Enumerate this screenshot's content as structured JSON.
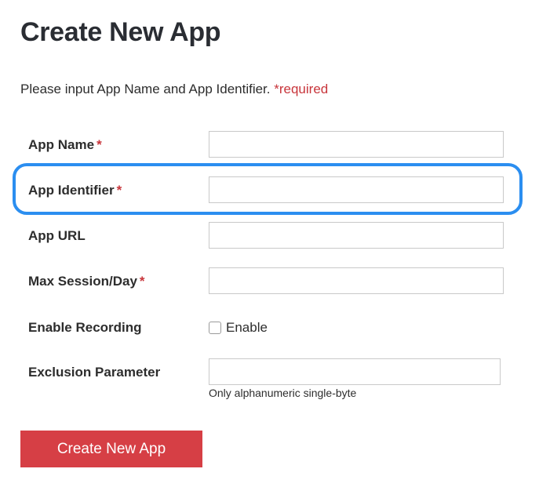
{
  "page": {
    "title": "Create New App",
    "intro": "Please input App Name and App Identifier. ",
    "intro_required": "*required"
  },
  "form": {
    "app_name": {
      "label": "App Name",
      "required_mark": "*",
      "value": ""
    },
    "app_identifier": {
      "label": "App Identifier",
      "required_mark": "*",
      "value": ""
    },
    "app_url": {
      "label": "App URL",
      "value": ""
    },
    "max_session": {
      "label": "Max Session/Day",
      "required_mark": "*",
      "value": ""
    },
    "enable_recording": {
      "label": "Enable Recording",
      "checkbox_label": "Enable",
      "checked": false
    },
    "exclusion_parameter": {
      "label": "Exclusion Parameter",
      "value": "",
      "hint": "Only alphanumeric single-byte"
    }
  },
  "submit": {
    "label": "Create New App"
  },
  "colors": {
    "accent": "#d63f45",
    "required": "#c8353b",
    "highlight": "#2b8ef0"
  }
}
